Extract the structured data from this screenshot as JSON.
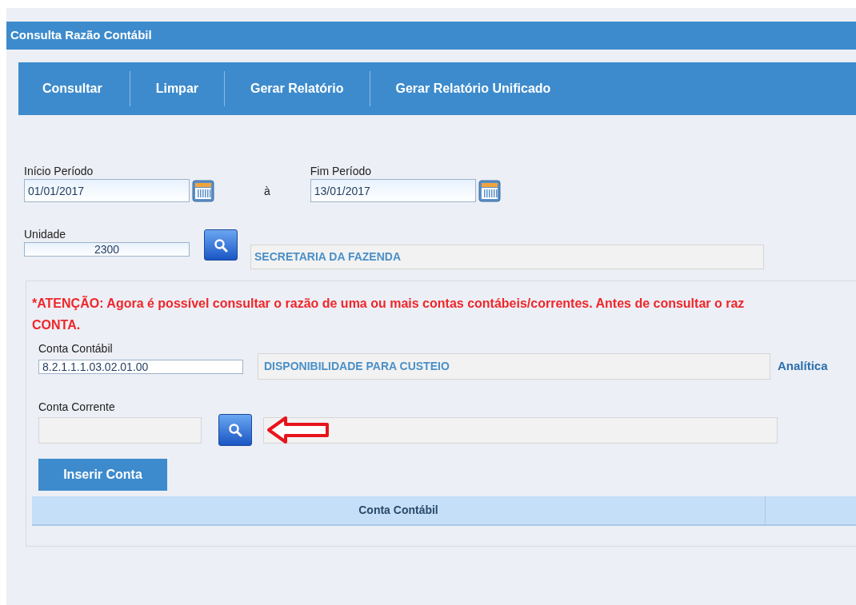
{
  "window": {
    "title": "Consulta Razão Contábil"
  },
  "toolbar": [
    {
      "label": "Consultar"
    },
    {
      "label": "Limpar"
    },
    {
      "label": "Gerar Relatório"
    },
    {
      "label": "Gerar Relatório Unificado"
    }
  ],
  "period": {
    "start_label": "Início Período",
    "start_value": "01/01/2017",
    "separator": "à",
    "end_label": "Fim Período",
    "end_value": "13/01/2017"
  },
  "unidade": {
    "label": "Unidade",
    "value": "2300",
    "description": "SECRETARIA DA FAZENDA"
  },
  "warning": [
    "*ATENÇÃO: Agora é possível consultar o razão de uma ou mais contas contábeis/correntes. Antes de consultar o raz",
    "CONTA."
  ],
  "conta_contabil": {
    "label": "Conta Contábil",
    "value": "8.2.1.1.1.03.02.01.00",
    "description": "DISPONIBILIDADE PARA CUSTEIO",
    "type": "Analítica"
  },
  "conta_corrente": {
    "label": "Conta Corrente"
  },
  "insert_button": "Inserir Conta",
  "table": {
    "columns": [
      "Conta Contábil"
    ]
  }
}
